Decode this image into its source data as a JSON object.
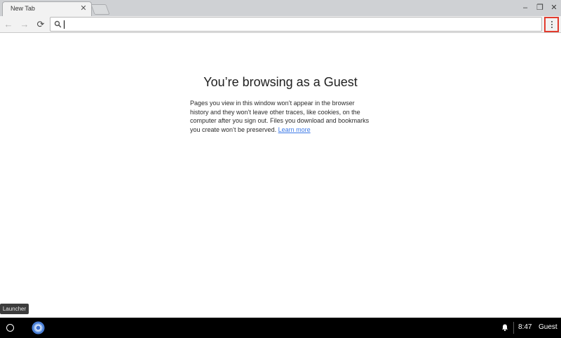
{
  "tab": {
    "title": "New Tab",
    "close_glyph": "✕"
  },
  "window_controls": {
    "minimize": "–",
    "restore": "❐",
    "close": "✕"
  },
  "toolbar": {
    "back_glyph": "←",
    "forward_glyph": "→",
    "reload_glyph": "⟳",
    "omnibox_value": ""
  },
  "content": {
    "title": "You’re browsing as a Guest",
    "description": "Pages you view in this window won’t appear in the browser history and they won’t leave other traces, like cookies, on the computer after you sign out. Files you download and bookmarks you create won’t be preserved.",
    "learn_more": "Learn more"
  },
  "tooltip": {
    "text": "Launcher"
  },
  "shelf": {
    "time": "8:47",
    "user": "Guest"
  },
  "colors": {
    "menu_highlight": "#e23b2e",
    "link": "#3b78e7",
    "shelf": "#000000"
  },
  "icons": {
    "search": "search-icon",
    "menu": "three-dot-menu-icon",
    "launcher": "launcher-circle-icon",
    "chrome": "chrome-icon",
    "notification": "bell-icon"
  }
}
